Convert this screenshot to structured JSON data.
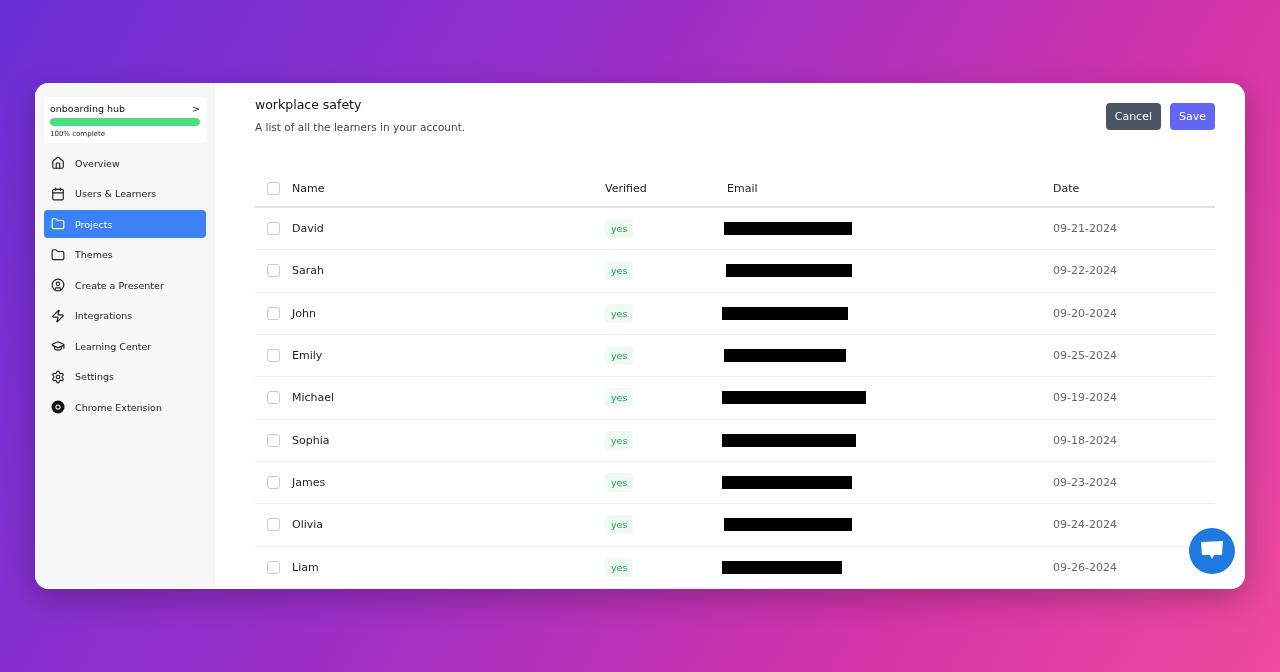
{
  "sidebar": {
    "hub": {
      "title": "onboarding hub",
      "chevron": ">",
      "level": 1,
      "progress_label": "100% complete"
    },
    "items": [
      {
        "label": "Overview",
        "selected": false
      },
      {
        "label": "Users & Learners",
        "selected": false
      },
      {
        "label": "Projects",
        "selected": true
      },
      {
        "label": "Themes",
        "selected": false
      },
      {
        "label": "Create a Presenter",
        "selected": false
      },
      {
        "label": "Integrations",
        "selected": false
      },
      {
        "label": "Learning Center",
        "selected": false
      },
      {
        "label": "Settings",
        "selected": false
      },
      {
        "label": "Chrome Extension",
        "selected": false
      }
    ]
  },
  "header": {
    "title": "workplace safety",
    "subtitle": "A list of all the learners in your account.",
    "buttons": [
      {
        "label": "Cancel",
        "kind": "secondary"
      },
      {
        "label": "Save",
        "kind": "primary"
      }
    ]
  },
  "table": {
    "columns": [
      "Name",
      "Verified",
      "Email",
      "Date"
    ],
    "header_checked": false,
    "rows": [
      {
        "name": "David",
        "verified": "yes",
        "date": "09-21-2024",
        "checked": false
      },
      {
        "name": "Sarah",
        "verified": "yes",
        "date": "09-22-2024",
        "checked": false
      },
      {
        "name": "John",
        "verified": "yes",
        "date": "09-20-2024",
        "checked": false
      },
      {
        "name": "Emily",
        "verified": "yes",
        "date": "09-25-2024",
        "checked": false
      },
      {
        "name": "Michael",
        "verified": "yes",
        "date": "09-19-2024",
        "checked": false
      },
      {
        "name": "Sophia",
        "verified": "yes",
        "date": "09-18-2024",
        "checked": false
      },
      {
        "name": "James",
        "verified": "yes",
        "date": "09-23-2024",
        "checked": false
      },
      {
        "name": "Olivia",
        "verified": "yes",
        "date": "09-24-2024",
        "checked": false
      },
      {
        "name": "Liam",
        "verified": "yes",
        "date": "09-26-2024",
        "checked": false
      }
    ]
  }
}
